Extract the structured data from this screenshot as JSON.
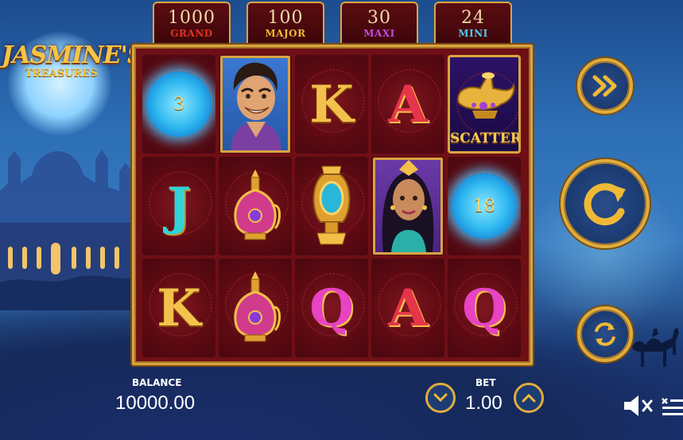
{
  "game": {
    "logo_main": "JASMINE'S",
    "logo_sub": "TREASURES"
  },
  "jackpots": [
    {
      "value": "1000",
      "label": "GRAND",
      "color": "#e0331f"
    },
    {
      "value": "100",
      "label": "MAJOR",
      "color": "#f0b935"
    },
    {
      "value": "30",
      "label": "MAXI",
      "color": "#c14ae0"
    },
    {
      "value": "24",
      "label": "MINI",
      "color": "#53c7ef"
    }
  ],
  "reels": {
    "rows": [
      [
        {
          "type": "orb",
          "value": "3"
        },
        {
          "type": "portrait",
          "symbol": "aladdin"
        },
        {
          "type": "letter",
          "value": "K",
          "style": "gold"
        },
        {
          "type": "letter",
          "value": "A",
          "style": "pink-red"
        },
        {
          "type": "scatter",
          "label": "SCATTER"
        }
      ],
      [
        {
          "type": "letter",
          "value": "J",
          "style": "teal"
        },
        {
          "type": "potion",
          "symbol": "perfume-bottle"
        },
        {
          "type": "lantern",
          "symbol": "golden-vase"
        },
        {
          "type": "portrait",
          "symbol": "jasmine"
        },
        {
          "type": "orb",
          "value": "18"
        }
      ],
      [
        {
          "type": "letter",
          "value": "K",
          "style": "gold"
        },
        {
          "type": "potion",
          "symbol": "perfume-bottle"
        },
        {
          "type": "letter",
          "value": "Q",
          "style": "pink"
        },
        {
          "type": "letter",
          "value": "A",
          "style": "pink-red"
        },
        {
          "type": "letter",
          "value": "Q",
          "style": "pink"
        }
      ]
    ]
  },
  "controls": {
    "balance_label": "BALANCE",
    "balance_value": "10000.00",
    "bet_label": "BET",
    "bet_value": "1.00"
  },
  "icons": {
    "turbo": "fast-forward-icon",
    "spin": "spin-arrow-icon",
    "autoplay": "autoplay-icon",
    "bet_down": "chevron-down-icon",
    "bet_up": "chevron-up-icon",
    "sound": "muted-speaker-icon",
    "menu": "menu-icon"
  }
}
